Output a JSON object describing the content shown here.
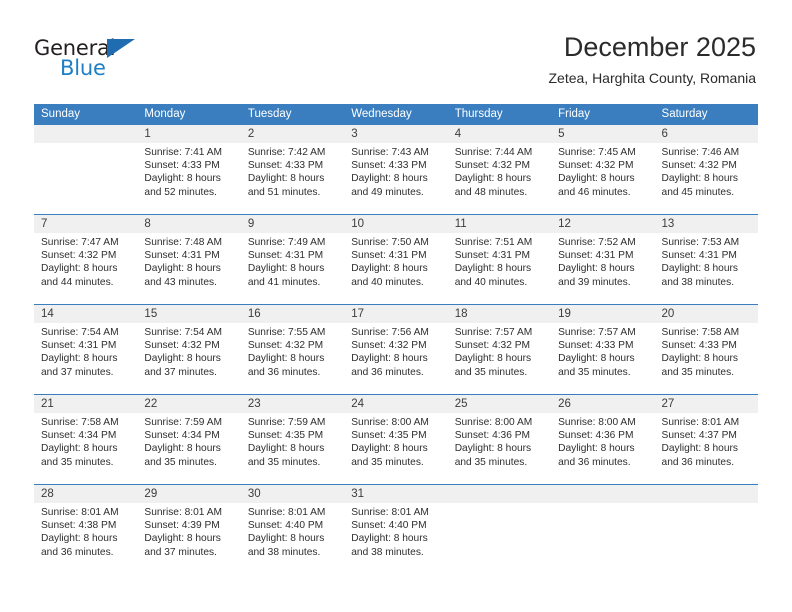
{
  "brand": {
    "name_part1": "General",
    "name_part2": "Blue",
    "color_dark": "#231f20",
    "color_blue": "#1f7fc4"
  },
  "header": {
    "month_title": "December 2025",
    "location": "Zetea, Harghita County, Romania"
  },
  "theme": {
    "header_band": "#3a7ebf",
    "daynum_band": "#f0f0f0",
    "text": "#2e2e2e"
  },
  "weekdays": [
    "Sunday",
    "Monday",
    "Tuesday",
    "Wednesday",
    "Thursday",
    "Friday",
    "Saturday"
  ],
  "weeks": [
    [
      {
        "day": "",
        "sunrise": "",
        "sunset": "",
        "daylight_line1": "",
        "daylight_line2": ""
      },
      {
        "day": "1",
        "sunrise": "Sunrise: 7:41 AM",
        "sunset": "Sunset: 4:33 PM",
        "daylight_line1": "Daylight: 8 hours",
        "daylight_line2": "and 52 minutes."
      },
      {
        "day": "2",
        "sunrise": "Sunrise: 7:42 AM",
        "sunset": "Sunset: 4:33 PM",
        "daylight_line1": "Daylight: 8 hours",
        "daylight_line2": "and 51 minutes."
      },
      {
        "day": "3",
        "sunrise": "Sunrise: 7:43 AM",
        "sunset": "Sunset: 4:33 PM",
        "daylight_line1": "Daylight: 8 hours",
        "daylight_line2": "and 49 minutes."
      },
      {
        "day": "4",
        "sunrise": "Sunrise: 7:44 AM",
        "sunset": "Sunset: 4:32 PM",
        "daylight_line1": "Daylight: 8 hours",
        "daylight_line2": "and 48 minutes."
      },
      {
        "day": "5",
        "sunrise": "Sunrise: 7:45 AM",
        "sunset": "Sunset: 4:32 PM",
        "daylight_line1": "Daylight: 8 hours",
        "daylight_line2": "and 46 minutes."
      },
      {
        "day": "6",
        "sunrise": "Sunrise: 7:46 AM",
        "sunset": "Sunset: 4:32 PM",
        "daylight_line1": "Daylight: 8 hours",
        "daylight_line2": "and 45 minutes."
      }
    ],
    [
      {
        "day": "7",
        "sunrise": "Sunrise: 7:47 AM",
        "sunset": "Sunset: 4:32 PM",
        "daylight_line1": "Daylight: 8 hours",
        "daylight_line2": "and 44 minutes."
      },
      {
        "day": "8",
        "sunrise": "Sunrise: 7:48 AM",
        "sunset": "Sunset: 4:31 PM",
        "daylight_line1": "Daylight: 8 hours",
        "daylight_line2": "and 43 minutes."
      },
      {
        "day": "9",
        "sunrise": "Sunrise: 7:49 AM",
        "sunset": "Sunset: 4:31 PM",
        "daylight_line1": "Daylight: 8 hours",
        "daylight_line2": "and 41 minutes."
      },
      {
        "day": "10",
        "sunrise": "Sunrise: 7:50 AM",
        "sunset": "Sunset: 4:31 PM",
        "daylight_line1": "Daylight: 8 hours",
        "daylight_line2": "and 40 minutes."
      },
      {
        "day": "11",
        "sunrise": "Sunrise: 7:51 AM",
        "sunset": "Sunset: 4:31 PM",
        "daylight_line1": "Daylight: 8 hours",
        "daylight_line2": "and 40 minutes."
      },
      {
        "day": "12",
        "sunrise": "Sunrise: 7:52 AM",
        "sunset": "Sunset: 4:31 PM",
        "daylight_line1": "Daylight: 8 hours",
        "daylight_line2": "and 39 minutes."
      },
      {
        "day": "13",
        "sunrise": "Sunrise: 7:53 AM",
        "sunset": "Sunset: 4:31 PM",
        "daylight_line1": "Daylight: 8 hours",
        "daylight_line2": "and 38 minutes."
      }
    ],
    [
      {
        "day": "14",
        "sunrise": "Sunrise: 7:54 AM",
        "sunset": "Sunset: 4:31 PM",
        "daylight_line1": "Daylight: 8 hours",
        "daylight_line2": "and 37 minutes."
      },
      {
        "day": "15",
        "sunrise": "Sunrise: 7:54 AM",
        "sunset": "Sunset: 4:32 PM",
        "daylight_line1": "Daylight: 8 hours",
        "daylight_line2": "and 37 minutes."
      },
      {
        "day": "16",
        "sunrise": "Sunrise: 7:55 AM",
        "sunset": "Sunset: 4:32 PM",
        "daylight_line1": "Daylight: 8 hours",
        "daylight_line2": "and 36 minutes."
      },
      {
        "day": "17",
        "sunrise": "Sunrise: 7:56 AM",
        "sunset": "Sunset: 4:32 PM",
        "daylight_line1": "Daylight: 8 hours",
        "daylight_line2": "and 36 minutes."
      },
      {
        "day": "18",
        "sunrise": "Sunrise: 7:57 AM",
        "sunset": "Sunset: 4:32 PM",
        "daylight_line1": "Daylight: 8 hours",
        "daylight_line2": "and 35 minutes."
      },
      {
        "day": "19",
        "sunrise": "Sunrise: 7:57 AM",
        "sunset": "Sunset: 4:33 PM",
        "daylight_line1": "Daylight: 8 hours",
        "daylight_line2": "and 35 minutes."
      },
      {
        "day": "20",
        "sunrise": "Sunrise: 7:58 AM",
        "sunset": "Sunset: 4:33 PM",
        "daylight_line1": "Daylight: 8 hours",
        "daylight_line2": "and 35 minutes."
      }
    ],
    [
      {
        "day": "21",
        "sunrise": "Sunrise: 7:58 AM",
        "sunset": "Sunset: 4:34 PM",
        "daylight_line1": "Daylight: 8 hours",
        "daylight_line2": "and 35 minutes."
      },
      {
        "day": "22",
        "sunrise": "Sunrise: 7:59 AM",
        "sunset": "Sunset: 4:34 PM",
        "daylight_line1": "Daylight: 8 hours",
        "daylight_line2": "and 35 minutes."
      },
      {
        "day": "23",
        "sunrise": "Sunrise: 7:59 AM",
        "sunset": "Sunset: 4:35 PM",
        "daylight_line1": "Daylight: 8 hours",
        "daylight_line2": "and 35 minutes."
      },
      {
        "day": "24",
        "sunrise": "Sunrise: 8:00 AM",
        "sunset": "Sunset: 4:35 PM",
        "daylight_line1": "Daylight: 8 hours",
        "daylight_line2": "and 35 minutes."
      },
      {
        "day": "25",
        "sunrise": "Sunrise: 8:00 AM",
        "sunset": "Sunset: 4:36 PM",
        "daylight_line1": "Daylight: 8 hours",
        "daylight_line2": "and 35 minutes."
      },
      {
        "day": "26",
        "sunrise": "Sunrise: 8:00 AM",
        "sunset": "Sunset: 4:36 PM",
        "daylight_line1": "Daylight: 8 hours",
        "daylight_line2": "and 36 minutes."
      },
      {
        "day": "27",
        "sunrise": "Sunrise: 8:01 AM",
        "sunset": "Sunset: 4:37 PM",
        "daylight_line1": "Daylight: 8 hours",
        "daylight_line2": "and 36 minutes."
      }
    ],
    [
      {
        "day": "28",
        "sunrise": "Sunrise: 8:01 AM",
        "sunset": "Sunset: 4:38 PM",
        "daylight_line1": "Daylight: 8 hours",
        "daylight_line2": "and 36 minutes."
      },
      {
        "day": "29",
        "sunrise": "Sunrise: 8:01 AM",
        "sunset": "Sunset: 4:39 PM",
        "daylight_line1": "Daylight: 8 hours",
        "daylight_line2": "and 37 minutes."
      },
      {
        "day": "30",
        "sunrise": "Sunrise: 8:01 AM",
        "sunset": "Sunset: 4:40 PM",
        "daylight_line1": "Daylight: 8 hours",
        "daylight_line2": "and 38 minutes."
      },
      {
        "day": "31",
        "sunrise": "Sunrise: 8:01 AM",
        "sunset": "Sunset: 4:40 PM",
        "daylight_line1": "Daylight: 8 hours",
        "daylight_line2": "and 38 minutes."
      },
      {
        "day": "",
        "sunrise": "",
        "sunset": "",
        "daylight_line1": "",
        "daylight_line2": ""
      },
      {
        "day": "",
        "sunrise": "",
        "sunset": "",
        "daylight_line1": "",
        "daylight_line2": ""
      },
      {
        "day": "",
        "sunrise": "",
        "sunset": "",
        "daylight_line1": "",
        "daylight_line2": ""
      }
    ]
  ]
}
